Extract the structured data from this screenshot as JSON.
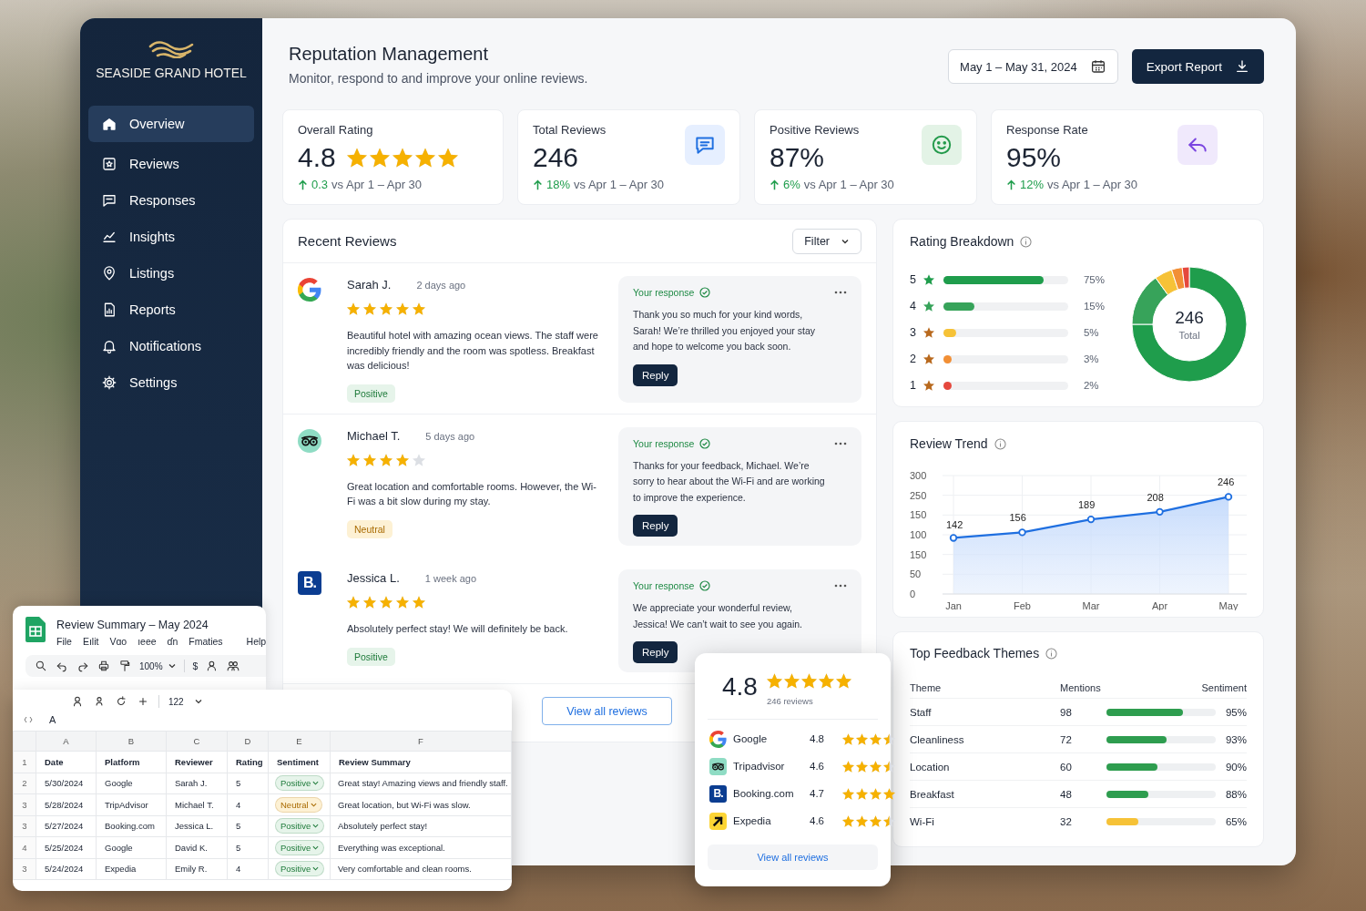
{
  "brand": {
    "name": "SEASIDE GRAND HOTEL"
  },
  "sidebar": {
    "items": [
      {
        "label": "Overview",
        "selected": true
      },
      {
        "label": "Reviews",
        "selected": false
      },
      {
        "label": "Responses",
        "selected": false
      },
      {
        "label": "Insights",
        "selected": false
      },
      {
        "label": "Listings",
        "selected": false
      },
      {
        "label": "Reports",
        "selected": false
      },
      {
        "label": "Notifications",
        "selected": false
      },
      {
        "label": "Settings",
        "selected": false
      }
    ]
  },
  "header": {
    "title": "Reputation Management",
    "subtitle": "Monitor, respond to and improve your online reviews.",
    "date_range": "May 1 – May 31, 2024",
    "export_button": "Export Report"
  },
  "kpis": [
    {
      "kind": "rating",
      "title": "Overall Rating",
      "value": "4.8",
      "stars": 5,
      "change": "0.3",
      "comparison": "vs Apr 1 – Apr 30"
    },
    {
      "kind": "reviews",
      "title": "Total Reviews",
      "value": "246",
      "change": "18%",
      "comparison": "vs Apr 1 – Apr 30"
    },
    {
      "kind": "positive",
      "title": "Positive Reviews",
      "value": "87%",
      "change": "6%",
      "comparison": "vs Apr 1 – Apr 30"
    },
    {
      "kind": "response",
      "title": "Response Rate",
      "value": "95%",
      "change": "12%",
      "comparison": "vs Apr 1 – Apr 30"
    }
  ],
  "recent_reviews": {
    "title": "Recent Reviews",
    "filter": "Filter",
    "view_all": "View all reviews",
    "items": [
      {
        "kind": "google",
        "name": "Sarah J.",
        "time": "2 days ago",
        "stars": 5,
        "text": "Beautiful hotel with amazing ocean views. The staff were incredibly friendly and the room was spotless. Breakfast was delicious!",
        "sentiment": {
          "kind": "positive",
          "label": "Positive"
        },
        "response": {
          "title": "Your response",
          "text": "Thank you so much for your kind words, Sarah! We’re thrilled you enjoyed your stay and hope to welcome you back soon.",
          "button": "Reply"
        }
      },
      {
        "kind": "tripadvisor",
        "name": "Michael T.",
        "time": "5 days ago",
        "stars": 4,
        "text": "Great location and comfortable rooms. However, the Wi-Fi was a bit slow during my stay.",
        "sentiment": {
          "kind": "neutral",
          "label": "Neutral"
        },
        "response": {
          "title": "Your response",
          "text": "Thanks for your feedback, Michael. We’re sorry to hear about the Wi-Fi and are working to improve the experience.",
          "button": "Reply"
        }
      },
      {
        "kind": "booking",
        "logo": "B.",
        "name": "Jessica L.",
        "time": "1 week ago",
        "stars": 5,
        "text": "Absolutely perfect stay! We will definitely be back.",
        "sentiment": {
          "kind": "positive",
          "label": "Positive"
        },
        "response": {
          "title": "Your response",
          "text": "We appreciate your wonderful review, Jessica! We can’t wait to see you again.",
          "button": "Reply"
        }
      }
    ]
  },
  "rating_breakdown": {
    "title": "Rating Breakdown",
    "rows": [
      {
        "label": "5",
        "percent": "75%",
        "level": 0.8,
        "color": "#1f9d4c"
      },
      {
        "label": "4",
        "percent": "15%",
        "level": 0.25,
        "color": "#37a35a"
      },
      {
        "label": "3",
        "percent": "5%",
        "level": 0.1,
        "color": "#f6c237"
      },
      {
        "label": "2",
        "percent": "3%",
        "level": 0.06,
        "color": "#f28f35"
      },
      {
        "label": "1",
        "percent": "2%",
        "level": 0.04,
        "color": "#e5483d"
      }
    ],
    "donut": {
      "total": "246",
      "caption": "Total",
      "chart_data": {
        "type": "donut",
        "values": [
          75,
          15,
          5,
          3,
          2
        ]
      }
    }
  },
  "review_trend": {
    "title": "Review Trend",
    "chart_data": {
      "type": "area",
      "categories": [
        "Jan",
        "Feb",
        "Mar",
        "Apr",
        "May"
      ],
      "series": [
        {
          "color": "#1f6fe0",
          "values": [
            142,
            156,
            189,
            208,
            246
          ]
        }
      ],
      "ylim": [
        0,
        300
      ],
      "grid": true,
      "data_labels": true
    },
    "y_axis_labels": [
      "300",
      "250",
      "150",
      "100",
      "150",
      "50",
      "0"
    ]
  },
  "feedback_themes": {
    "title": "Top Feedback Themes",
    "columns": [
      "Theme",
      "Mentions",
      "Sentiment"
    ],
    "rows": [
      {
        "theme": "Staff",
        "mentions": "98",
        "level": 0.7,
        "percent": "95%",
        "color": "#2e9d4f"
      },
      {
        "theme": "Cleanliness",
        "mentions": "72",
        "level": 0.55,
        "percent": "93%",
        "color": "#2e9d4f"
      },
      {
        "theme": "Location",
        "mentions": "60",
        "level": 0.47,
        "percent": "90%",
        "color": "#2e9d4f"
      },
      {
        "theme": "Breakfast",
        "mentions": "48",
        "level": 0.38,
        "percent": "88%",
        "color": "#2e9d4f"
      },
      {
        "theme": "Wi-Fi",
        "mentions": "32",
        "level": 0.29,
        "percent": "65%",
        "color": "#f6c237"
      }
    ]
  },
  "spreadsheet": {
    "title": "Review Summary – May 2024",
    "menu": [
      "File",
      "Eılit",
      "Vɑo",
      "ıeee",
      "ɗn",
      "Fmaties",
      "Help"
    ],
    "zoom": "100%",
    "currency": "$",
    "font_size": "122",
    "cell_ref": "A",
    "columns": [
      "A",
      "B",
      "C",
      "D",
      "E",
      "F"
    ],
    "header_row": {
      "number": "1",
      "cells": [
        "Date",
        "Platform",
        "Reviewer",
        "Rating",
        "Sentiment",
        "Review Summary"
      ]
    },
    "rows": [
      {
        "number": "2",
        "date": "5/30/2024",
        "platform": "Google",
        "reviewer": "Sarah J.",
        "rating": "5",
        "sentiment": {
          "kind": "positive",
          "label": "Positive"
        },
        "summary": "Great stay! Amazing views and friendly staff."
      },
      {
        "number": "3",
        "date": "5/28/2024",
        "platform": "TripAdvisor",
        "reviewer": "Michael T.",
        "rating": "4",
        "sentiment": {
          "kind": "neutral",
          "label": "Neutral"
        },
        "summary": "Great location, but Wi-Fi was slow."
      },
      {
        "number": "3",
        "date": "5/27/2024",
        "platform": "Booking.com",
        "reviewer": "Jessica L.",
        "rating": "5",
        "sentiment": {
          "kind": "positive",
          "label": "Positive"
        },
        "summary": "Absolutely perfect stay!"
      },
      {
        "number": "4",
        "date": "5/25/2024",
        "platform": "Google",
        "reviewer": "David K.",
        "rating": "5",
        "sentiment": {
          "kind": "positive",
          "label": "Positive"
        },
        "summary": "Everything was exceptional."
      },
      {
        "number": "3",
        "date": "5/24/2024",
        "platform": "Expedia",
        "reviewer": "Emily R.",
        "rating": "4",
        "sentiment": {
          "kind": "positive",
          "label": "Positive"
        },
        "summary": "Very comfortable and clean rooms."
      }
    ]
  },
  "rating_popup": {
    "rating": "4.8",
    "stars": 5,
    "count": "246 reviews",
    "view_all": "View all reviews",
    "platforms": [
      {
        "kind": "google",
        "name": "Google",
        "score": "4.8",
        "stars": 3.5
      },
      {
        "kind": "tripadvisor",
        "name": "Tripadvisor",
        "score": "4.6",
        "stars": 3.5
      },
      {
        "kind": "booking",
        "logo": "B.",
        "name": "Booking.com",
        "score": "4.7",
        "stars": 4
      },
      {
        "kind": "expedia",
        "name": "Expedia",
        "score": "4.6",
        "stars": 3.5
      }
    ]
  }
}
